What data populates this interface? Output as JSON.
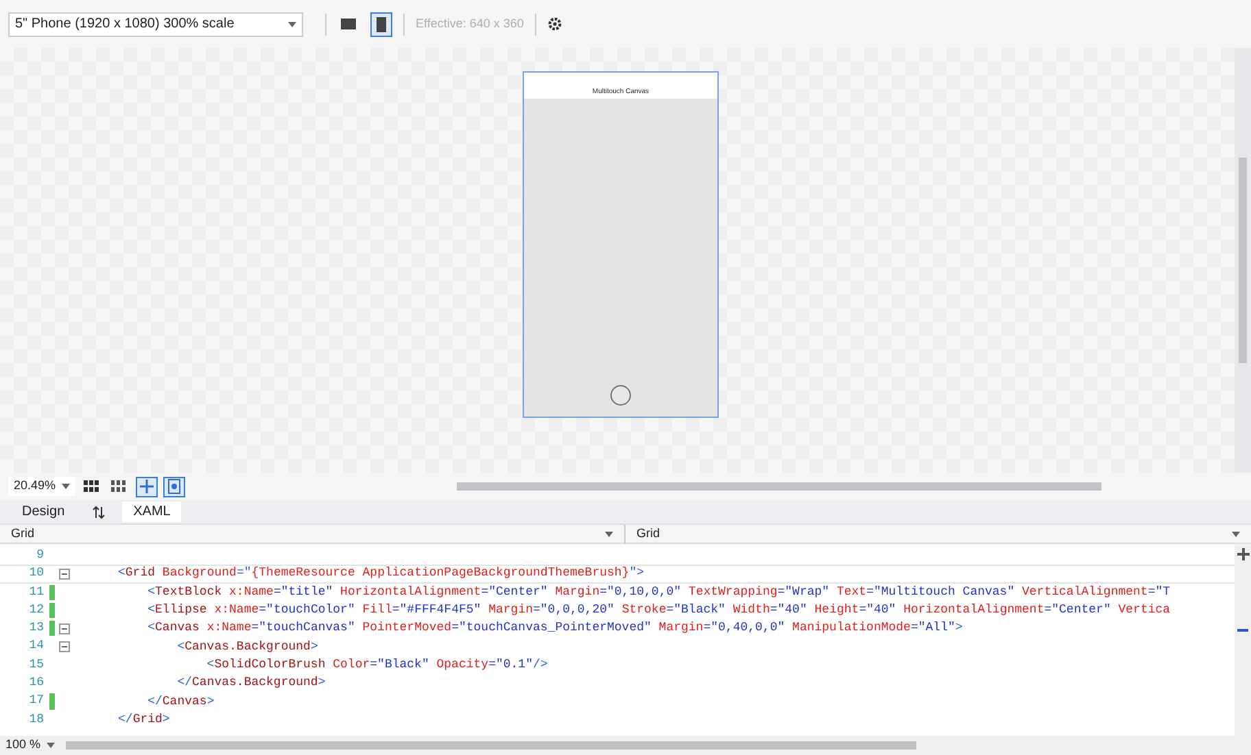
{
  "toolbar": {
    "device": "5\" Phone (1920 x 1080) 300% scale",
    "orientations": [
      {
        "kind": "landscape",
        "selected": false
      },
      {
        "kind": "portrait",
        "selected": true
      }
    ],
    "effective": "Effective: 640 x 360"
  },
  "designer": {
    "page_title": "Multitouch Canvas"
  },
  "zoom_bar": {
    "zoom": "20.49%",
    "toggles": [
      {
        "kind": "grid",
        "on": false
      },
      {
        "kind": "grid-small",
        "on": false
      },
      {
        "kind": "snap",
        "on": true
      },
      {
        "kind": "artboard",
        "on": true
      }
    ]
  },
  "tabs": [
    {
      "label": "Design",
      "selected": false
    },
    {
      "label": "XAML",
      "selected": true
    }
  ],
  "selectors": {
    "left": "Grid",
    "right": "Grid"
  },
  "code": [
    {
      "number": "9",
      "changed": false,
      "fold": false,
      "current": false
    },
    {
      "number": "10",
      "changed": false,
      "fold": true,
      "current": true,
      "tokens": [
        {
          "kind": "punct",
          "text": "<"
        },
        {
          "kind": "tag",
          "text": "Grid"
        },
        {
          "kind": "attr",
          "text": " Background"
        },
        {
          "kind": "punct",
          "text": "=\""
        },
        {
          "kind": "attr",
          "text": "{ThemeResource ApplicationPageBackgroundThemeBrush}"
        },
        {
          "kind": "punct",
          "text": "\">"
        }
      ]
    },
    {
      "number": "11",
      "changed": true,
      "fold": false,
      "current": false,
      "tokens": [
        {
          "kind": "punct",
          "text": "    <"
        },
        {
          "kind": "tag",
          "text": "TextBlock"
        },
        {
          "kind": "attr",
          "text": " x:Name"
        },
        {
          "kind": "value",
          "text": "=\"title\""
        },
        {
          "kind": "attr",
          "text": " HorizontalAlignment"
        },
        {
          "kind": "value",
          "text": "=\"Center\""
        },
        {
          "kind": "attr",
          "text": " Margin"
        },
        {
          "kind": "value",
          "text": "=\"0,10,0,0\""
        },
        {
          "kind": "attr",
          "text": " TextWrapping"
        },
        {
          "kind": "value",
          "text": "=\"Wrap\""
        },
        {
          "kind": "attr",
          "text": " Text"
        },
        {
          "kind": "value",
          "text": "=\"Multitouch Canvas\""
        },
        {
          "kind": "attr",
          "text": " VerticalAlignment"
        },
        {
          "kind": "value",
          "text": "=\"T"
        }
      ]
    },
    {
      "number": "12",
      "changed": true,
      "fold": false,
      "current": false,
      "tokens": [
        {
          "kind": "punct",
          "text": "    <"
        },
        {
          "kind": "tag",
          "text": "Ellipse"
        },
        {
          "kind": "attr",
          "text": " x:Name"
        },
        {
          "kind": "value",
          "text": "=\"touchColor\""
        },
        {
          "kind": "attr",
          "text": " Fill"
        },
        {
          "kind": "value",
          "text": "=\"#FFF4F4F5\""
        },
        {
          "kind": "attr",
          "text": " Margin"
        },
        {
          "kind": "value",
          "text": "=\"0,0,0,20\""
        },
        {
          "kind": "attr",
          "text": " Stroke"
        },
        {
          "kind": "value",
          "text": "=\"Black\""
        },
        {
          "kind": "attr",
          "text": " Width"
        },
        {
          "kind": "value",
          "text": "=\"40\""
        },
        {
          "kind": "attr",
          "text": " Height"
        },
        {
          "kind": "value",
          "text": "=\"40\""
        },
        {
          "kind": "attr",
          "text": " HorizontalAlignment"
        },
        {
          "kind": "value",
          "text": "=\"Center\""
        },
        {
          "kind": "attr",
          "text": " Vertica"
        }
      ]
    },
    {
      "number": "13",
      "changed": true,
      "fold": true,
      "current": false,
      "tokens": [
        {
          "kind": "punct",
          "text": "    <"
        },
        {
          "kind": "tag",
          "text": "Canvas"
        },
        {
          "kind": "attr",
          "text": " x:Name"
        },
        {
          "kind": "value",
          "text": "=\"touchCanvas\""
        },
        {
          "kind": "attr",
          "text": " PointerMoved"
        },
        {
          "kind": "value",
          "text": "=\"touchCanvas_PointerMoved\""
        },
        {
          "kind": "attr",
          "text": " Margin"
        },
        {
          "kind": "value",
          "text": "=\"0,40,0,0\""
        },
        {
          "kind": "attr",
          "text": " ManipulationMode"
        },
        {
          "kind": "value",
          "text": "=\"All\""
        },
        {
          "kind": "punct",
          "text": ">"
        }
      ]
    },
    {
      "number": "14",
      "changed": false,
      "fold": true,
      "current": false,
      "tokens": [
        {
          "kind": "punct",
          "text": "        <"
        },
        {
          "kind": "tag",
          "text": "Canvas.Background"
        },
        {
          "kind": "punct",
          "text": ">"
        }
      ]
    },
    {
      "number": "15",
      "changed": false,
      "fold": false,
      "current": false,
      "tokens": [
        {
          "kind": "punct",
          "text": "            <"
        },
        {
          "kind": "tag",
          "text": "SolidColorBrush"
        },
        {
          "kind": "attr",
          "text": " Color"
        },
        {
          "kind": "value",
          "text": "=\"Black\""
        },
        {
          "kind": "attr",
          "text": " Opacity"
        },
        {
          "kind": "value",
          "text": "=\"0.1\""
        },
        {
          "kind": "punct",
          "text": "/>"
        }
      ]
    },
    {
      "number": "16",
      "changed": false,
      "fold": false,
      "current": false,
      "tokens": [
        {
          "kind": "punct",
          "text": "        </"
        },
        {
          "kind": "tag",
          "text": "Canvas.Background"
        },
        {
          "kind": "punct",
          "text": ">"
        }
      ]
    },
    {
      "number": "17",
      "changed": true,
      "fold": false,
      "current": false,
      "tokens": [
        {
          "kind": "punct",
          "text": "    </"
        },
        {
          "kind": "tag",
          "text": "Canvas"
        },
        {
          "kind": "punct",
          "text": ">"
        }
      ]
    },
    {
      "number": "18",
      "changed": false,
      "fold": false,
      "current": false,
      "tokens": [
        {
          "kind": "punct",
          "text": "</"
        },
        {
          "kind": "tag",
          "text": "Grid"
        },
        {
          "kind": "punct",
          "text": ">"
        }
      ]
    }
  ],
  "status": {
    "zoom": "100 %"
  }
}
